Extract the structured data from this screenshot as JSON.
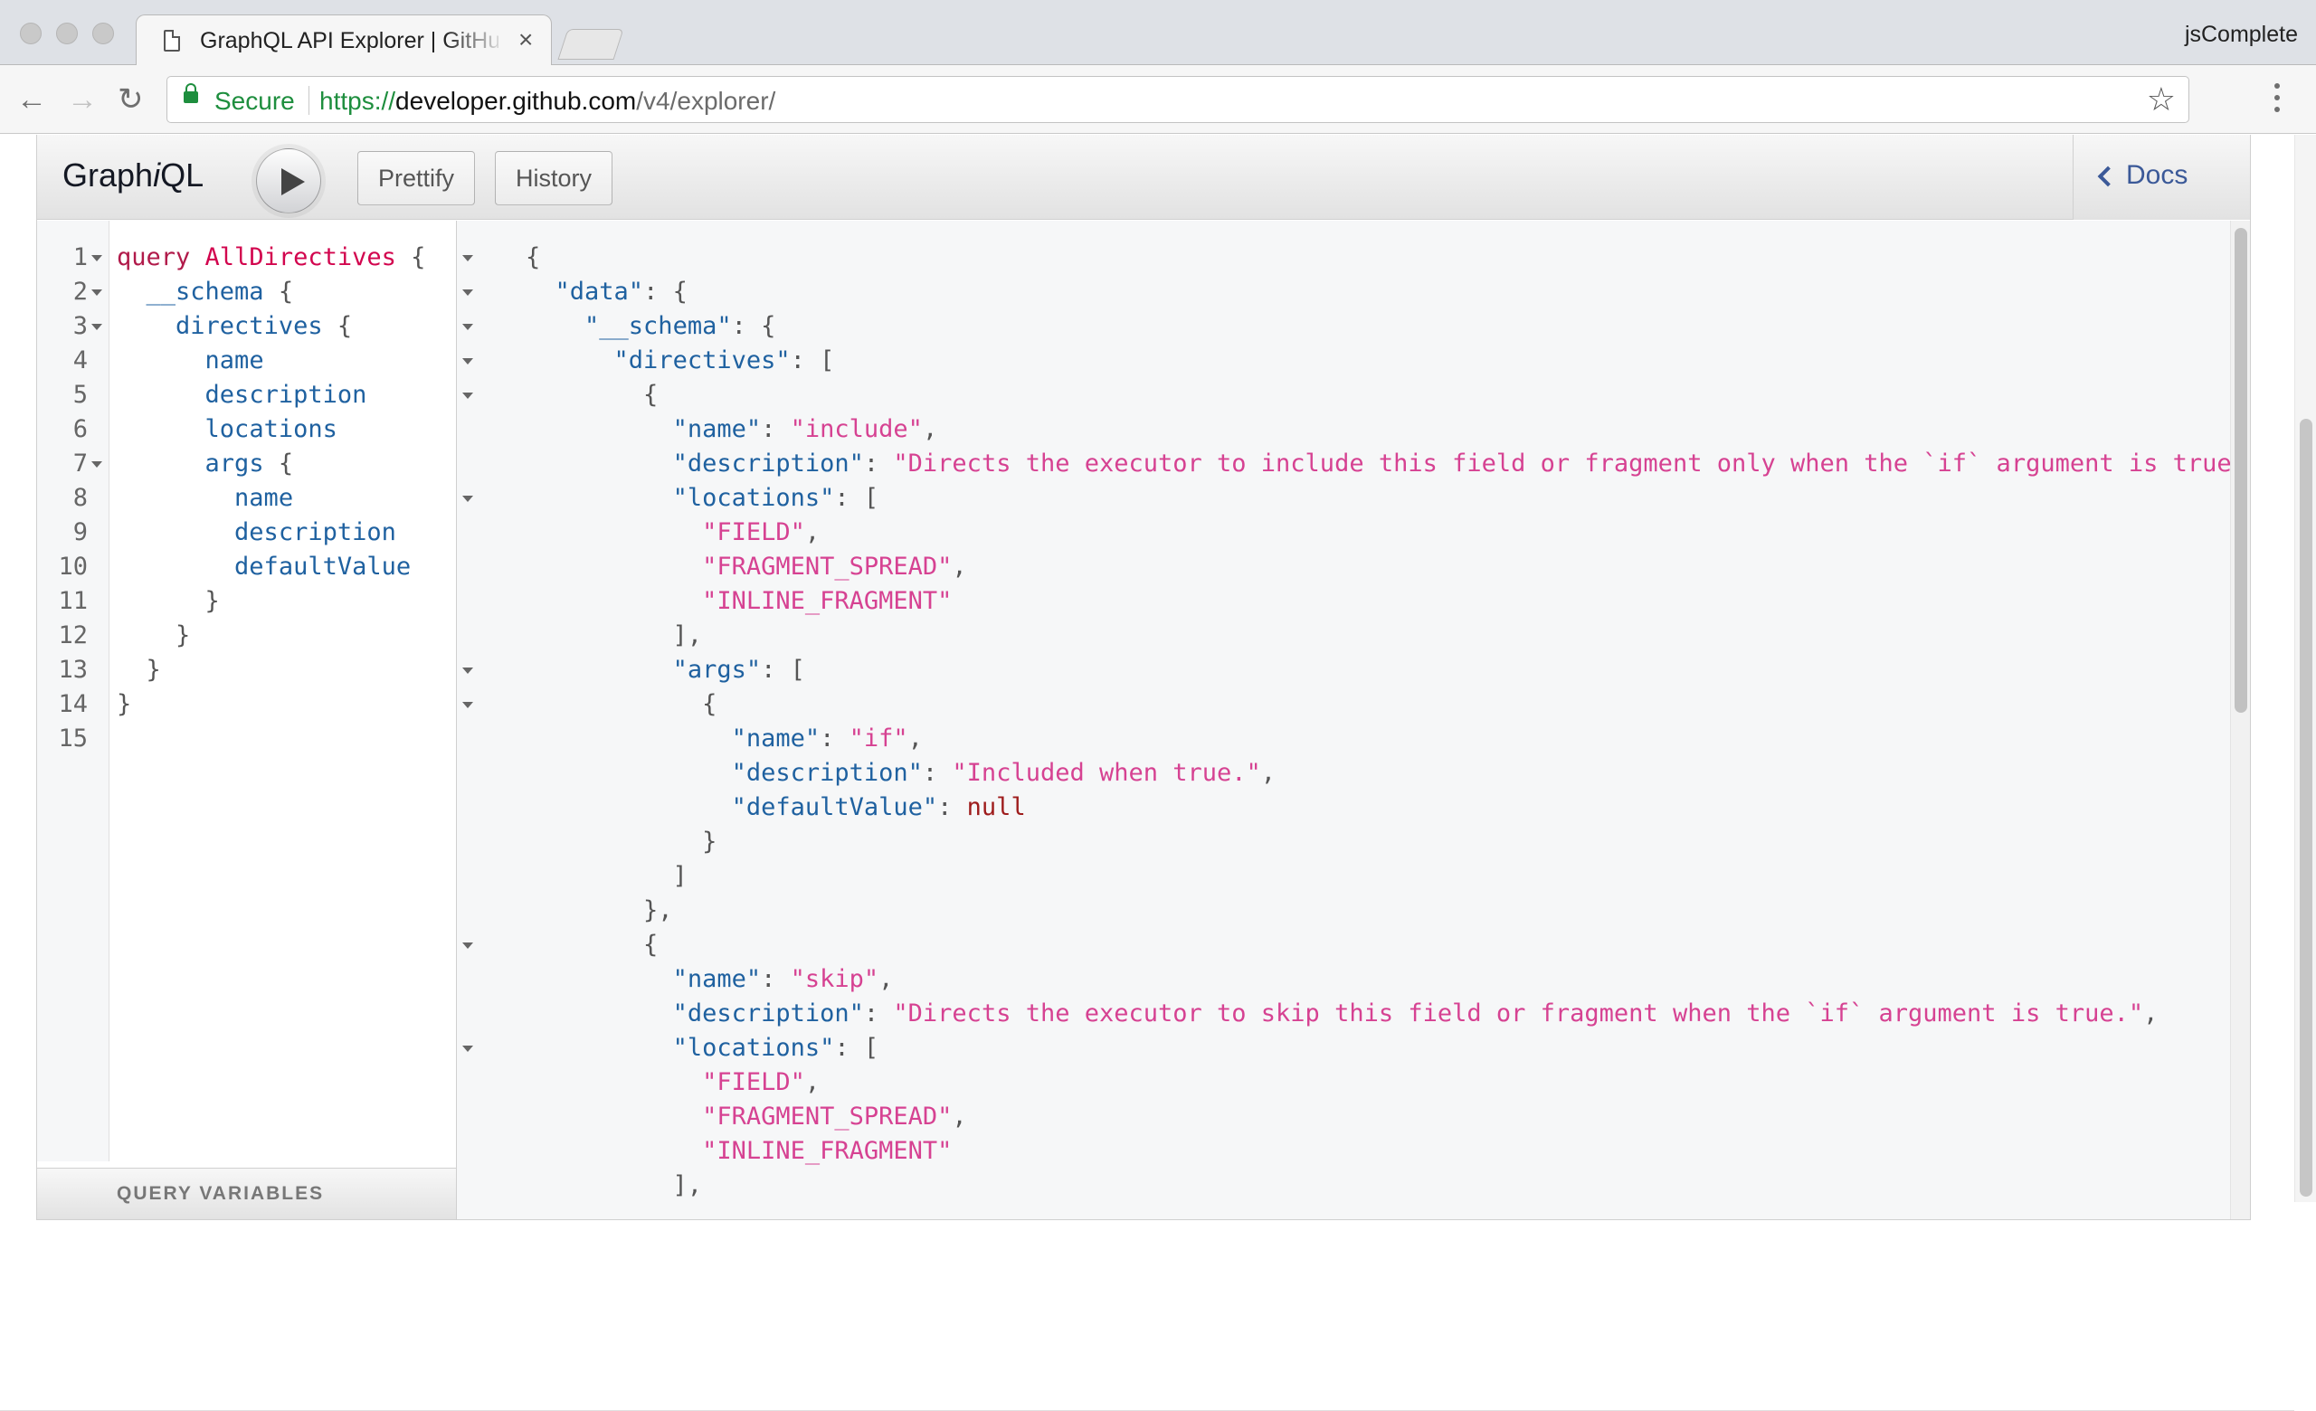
{
  "browser": {
    "tab_title": "GraphQL API Explorer | GitHub",
    "tab_close": "×",
    "profile": "jsComplete",
    "secure_label": "Secure",
    "url_scheme": "https://",
    "url_host": "developer.github.com",
    "url_path": "/v4/explorer/",
    "back_icon": "←",
    "forward_icon": "→",
    "reload_icon": "↻",
    "star_icon": "☆"
  },
  "graphiql": {
    "title_pre": "Graph",
    "title_i": "i",
    "title_post": "QL",
    "prettify_label": "Prettify",
    "history_label": "History",
    "docs_label": "Docs",
    "query_variables_label": "QUERY VARIABLES"
  },
  "query_lines": [
    {
      "n": "1",
      "fold": true,
      "tokens": [
        [
          "kw",
          "query"
        ],
        [
          "pun",
          " "
        ],
        [
          "def",
          "AllDirectives"
        ],
        [
          "pun",
          " {"
        ]
      ]
    },
    {
      "n": "2",
      "fold": true,
      "tokens": [
        [
          "pun",
          "  "
        ],
        [
          "fld",
          "__schema"
        ],
        [
          "pun",
          " {"
        ]
      ]
    },
    {
      "n": "3",
      "fold": true,
      "tokens": [
        [
          "pun",
          "    "
        ],
        [
          "fld",
          "directives"
        ],
        [
          "pun",
          " {"
        ]
      ]
    },
    {
      "n": "4",
      "fold": false,
      "tokens": [
        [
          "pun",
          "      "
        ],
        [
          "fld",
          "name"
        ]
      ]
    },
    {
      "n": "5",
      "fold": false,
      "tokens": [
        [
          "pun",
          "      "
        ],
        [
          "fld",
          "description"
        ]
      ]
    },
    {
      "n": "6",
      "fold": false,
      "tokens": [
        [
          "pun",
          "      "
        ],
        [
          "fld",
          "locations"
        ]
      ]
    },
    {
      "n": "7",
      "fold": true,
      "tokens": [
        [
          "pun",
          "      "
        ],
        [
          "fld",
          "args"
        ],
        [
          "pun",
          " {"
        ]
      ]
    },
    {
      "n": "8",
      "fold": false,
      "tokens": [
        [
          "pun",
          "        "
        ],
        [
          "fld",
          "name"
        ]
      ]
    },
    {
      "n": "9",
      "fold": false,
      "tokens": [
        [
          "pun",
          "        "
        ],
        [
          "fld",
          "description"
        ]
      ]
    },
    {
      "n": "10",
      "fold": false,
      "tokens": [
        [
          "pun",
          "        "
        ],
        [
          "fld",
          "defaultValue"
        ]
      ]
    },
    {
      "n": "11",
      "fold": false,
      "tokens": [
        [
          "pun",
          "      }"
        ]
      ]
    },
    {
      "n": "12",
      "fold": false,
      "tokens": [
        [
          "pun",
          "    }"
        ]
      ]
    },
    {
      "n": "13",
      "fold": false,
      "tokens": [
        [
          "pun",
          "  }"
        ]
      ]
    },
    {
      "n": "14",
      "fold": false,
      "tokens": [
        [
          "pun",
          "}"
        ]
      ]
    },
    {
      "n": "15",
      "fold": false,
      "tokens": []
    }
  ],
  "result_lines": [
    {
      "fold": true,
      "tokens": [
        [
          "pun",
          "{"
        ]
      ]
    },
    {
      "fold": true,
      "tokens": [
        [
          "pun",
          "  "
        ],
        [
          "attr",
          "\"data\""
        ],
        [
          "pun",
          ": {"
        ]
      ]
    },
    {
      "fold": true,
      "tokens": [
        [
          "pun",
          "    "
        ],
        [
          "attr",
          "\"__schema\""
        ],
        [
          "pun",
          ": {"
        ]
      ]
    },
    {
      "fold": true,
      "tokens": [
        [
          "pun",
          "      "
        ],
        [
          "attr",
          "\"directives\""
        ],
        [
          "pun",
          ": ["
        ]
      ]
    },
    {
      "fold": true,
      "tokens": [
        [
          "pun",
          "        {"
        ]
      ]
    },
    {
      "fold": false,
      "tokens": [
        [
          "pun",
          "          "
        ],
        [
          "attr",
          "\"name\""
        ],
        [
          "pun",
          ": "
        ],
        [
          "str",
          "\"include\""
        ],
        [
          "pun",
          ","
        ]
      ]
    },
    {
      "fold": false,
      "tokens": [
        [
          "pun",
          "          "
        ],
        [
          "attr",
          "\"description\""
        ],
        [
          "pun",
          ": "
        ],
        [
          "str",
          "\"Directs the executor to include this field or fragment only when the `if` argument is true.\""
        ],
        [
          "pun",
          ","
        ]
      ]
    },
    {
      "fold": true,
      "tokens": [
        [
          "pun",
          "          "
        ],
        [
          "attr",
          "\"locations\""
        ],
        [
          "pun",
          ": ["
        ]
      ]
    },
    {
      "fold": false,
      "tokens": [
        [
          "pun",
          "            "
        ],
        [
          "str",
          "\"FIELD\""
        ],
        [
          "pun",
          ","
        ]
      ]
    },
    {
      "fold": false,
      "tokens": [
        [
          "pun",
          "            "
        ],
        [
          "str",
          "\"FRAGMENT_SPREAD\""
        ],
        [
          "pun",
          ","
        ]
      ]
    },
    {
      "fold": false,
      "tokens": [
        [
          "pun",
          "            "
        ],
        [
          "str",
          "\"INLINE_FRAGMENT\""
        ]
      ]
    },
    {
      "fold": false,
      "tokens": [
        [
          "pun",
          "          ],"
        ]
      ]
    },
    {
      "fold": true,
      "tokens": [
        [
          "pun",
          "          "
        ],
        [
          "attr",
          "\"args\""
        ],
        [
          "pun",
          ": ["
        ]
      ]
    },
    {
      "fold": true,
      "tokens": [
        [
          "pun",
          "            {"
        ]
      ]
    },
    {
      "fold": false,
      "tokens": [
        [
          "pun",
          "              "
        ],
        [
          "attr",
          "\"name\""
        ],
        [
          "pun",
          ": "
        ],
        [
          "str",
          "\"if\""
        ],
        [
          "pun",
          ","
        ]
      ]
    },
    {
      "fold": false,
      "tokens": [
        [
          "pun",
          "              "
        ],
        [
          "attr",
          "\"description\""
        ],
        [
          "pun",
          ": "
        ],
        [
          "str",
          "\"Included when true.\""
        ],
        [
          "pun",
          ","
        ]
      ]
    },
    {
      "fold": false,
      "tokens": [
        [
          "pun",
          "              "
        ],
        [
          "attr",
          "\"defaultValue\""
        ],
        [
          "pun",
          ": "
        ],
        [
          "kwnull",
          "null"
        ]
      ]
    },
    {
      "fold": false,
      "tokens": [
        [
          "pun",
          "            }"
        ]
      ]
    },
    {
      "fold": false,
      "tokens": [
        [
          "pun",
          "          ]"
        ]
      ]
    },
    {
      "fold": false,
      "tokens": [
        [
          "pun",
          "        },"
        ]
      ]
    },
    {
      "fold": true,
      "tokens": [
        [
          "pun",
          "        {"
        ]
      ]
    },
    {
      "fold": false,
      "tokens": [
        [
          "pun",
          "          "
        ],
        [
          "attr",
          "\"name\""
        ],
        [
          "pun",
          ": "
        ],
        [
          "str",
          "\"skip\""
        ],
        [
          "pun",
          ","
        ]
      ]
    },
    {
      "fold": false,
      "tokens": [
        [
          "pun",
          "          "
        ],
        [
          "attr",
          "\"description\""
        ],
        [
          "pun",
          ": "
        ],
        [
          "str",
          "\"Directs the executor to skip this field or fragment when the `if` argument is true.\""
        ],
        [
          "pun",
          ","
        ]
      ]
    },
    {
      "fold": true,
      "tokens": [
        [
          "pun",
          "          "
        ],
        [
          "attr",
          "\"locations\""
        ],
        [
          "pun",
          ": ["
        ]
      ]
    },
    {
      "fold": false,
      "tokens": [
        [
          "pun",
          "            "
        ],
        [
          "str",
          "\"FIELD\""
        ],
        [
          "pun",
          ","
        ]
      ]
    },
    {
      "fold": false,
      "tokens": [
        [
          "pun",
          "            "
        ],
        [
          "str",
          "\"FRAGMENT_SPREAD\""
        ],
        [
          "pun",
          ","
        ]
      ]
    },
    {
      "fold": false,
      "tokens": [
        [
          "pun",
          "            "
        ],
        [
          "str",
          "\"INLINE_FRAGMENT\""
        ]
      ]
    },
    {
      "fold": false,
      "tokens": [
        [
          "pun",
          "          ],"
        ]
      ]
    }
  ]
}
